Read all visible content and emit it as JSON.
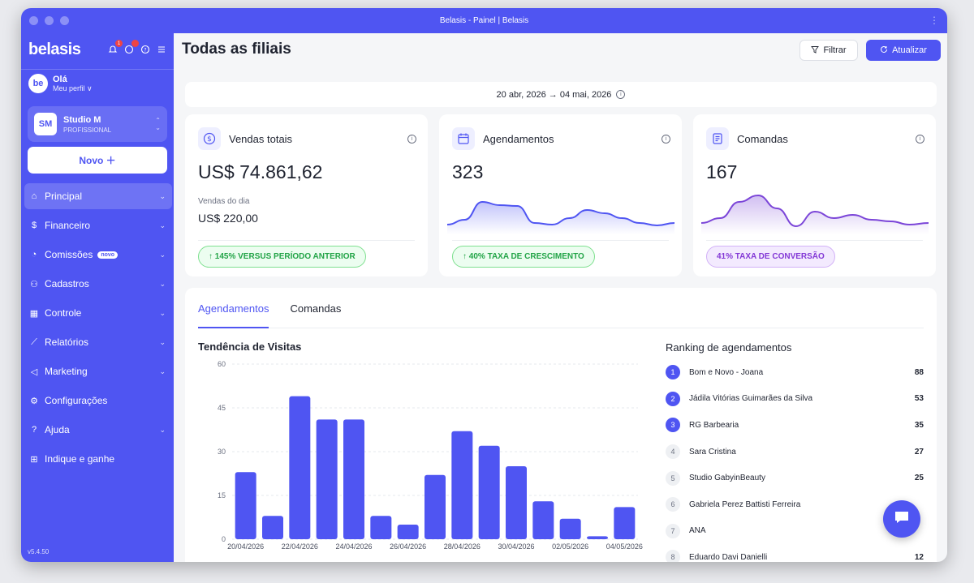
{
  "window": {
    "title": "Belasis - Painel | Belasis"
  },
  "sidebar": {
    "logo": "belasis",
    "notif_count": "1",
    "user": {
      "avatar": "be",
      "hello": "Olá",
      "profile": "Meu perfil ∨"
    },
    "studio": {
      "avatar": "SM",
      "name": "Studio M",
      "role": "PROFISSIONAL"
    },
    "new_button": "Novo ＋",
    "items": [
      {
        "label": "Principal",
        "icon": "home-icon",
        "glyph": "⌂",
        "chevron": true,
        "active": true
      },
      {
        "label": "Financeiro",
        "icon": "dollar-circle-icon",
        "glyph": "$",
        "chevron": true
      },
      {
        "label": "Comissões",
        "icon": "pie-icon",
        "glyph": "◔",
        "chevron": true,
        "badge": "novo"
      },
      {
        "label": "Cadastros",
        "icon": "users-icon",
        "glyph": "⚇",
        "chevron": true
      },
      {
        "label": "Controle",
        "icon": "grid-icon",
        "glyph": "▦",
        "chevron": true
      },
      {
        "label": "Relatórios",
        "icon": "chart-line-icon",
        "glyph": "⟋",
        "chevron": true
      },
      {
        "label": "Marketing",
        "icon": "megaphone-icon",
        "glyph": "◁",
        "chevron": true
      },
      {
        "label": "Configurações",
        "icon": "gear-icon",
        "glyph": "⚙",
        "chevron": false
      },
      {
        "label": "Ajuda",
        "icon": "help-icon",
        "glyph": "?",
        "chevron": true
      },
      {
        "label": "Indique e ganhe",
        "icon": "gift-icon",
        "glyph": "⊞",
        "chevron": false
      }
    ],
    "version": "v5.4.50"
  },
  "header": {
    "title": "Todas as filiais",
    "filter_label": "Filtrar",
    "update_label": "Atualizar"
  },
  "date_range": "20 abr, 2026 → 04 mai, 2026",
  "cards": {
    "sales": {
      "title": "Vendas totais",
      "value": "US$ 74.861,62",
      "sub_label": "Vendas do dia",
      "sub_value": "US$ 220,00",
      "pill": "↑ 145% VERSUS PERÍODO ANTERIOR"
    },
    "appointments": {
      "title": "Agendamentos",
      "value": "323",
      "pill": "↑ 40% TAXA DE CRESCIMENTO"
    },
    "orders": {
      "title": "Comandas",
      "value": "167",
      "pill": "41% TAXA DE CONVERSÃO"
    }
  },
  "colors": {
    "brand": "#4f55f2",
    "green": "#22a447",
    "purple": "#8338d6",
    "purple_line": "#7b45d8"
  },
  "tabs": [
    {
      "label": "Agendamentos",
      "active": true
    },
    {
      "label": "Comandas",
      "active": false
    }
  ],
  "chart_data": {
    "type": "bar",
    "title": "Tendência de Visitas",
    "x_tick_labels": [
      "20/04/2026",
      "22/04/2026",
      "24/04/2026",
      "26/04/2026",
      "28/04/2026",
      "30/04/2026",
      "02/05/2026",
      "04/05/2026"
    ],
    "categories": [
      "20/04/2026",
      "21/04/2026",
      "22/04/2026",
      "23/04/2026",
      "24/04/2026",
      "25/04/2026",
      "26/04/2026",
      "27/04/2026",
      "28/04/2026",
      "29/04/2026",
      "30/04/2026",
      "01/05/2026",
      "02/05/2026",
      "03/05/2026",
      "04/05/2026"
    ],
    "values": [
      23,
      8,
      49,
      41,
      41,
      8,
      5,
      22,
      37,
      32,
      25,
      13,
      7,
      1,
      11
    ],
    "ylim": [
      0,
      60
    ],
    "yticks": [
      0,
      15,
      30,
      45,
      60
    ],
    "grid": true
  },
  "sparklines": {
    "appointments": [
      12,
      18,
      40,
      36,
      35,
      14,
      12,
      20,
      30,
      26,
      20,
      14,
      11,
      14
    ],
    "orders": [
      14,
      20,
      40,
      48,
      32,
      10,
      28,
      20,
      24,
      18,
      16,
      12,
      14
    ]
  },
  "ranking": {
    "title": "Ranking de agendamentos",
    "items": [
      {
        "pos": "1",
        "name": "Bom e Novo - Joana",
        "count": "88"
      },
      {
        "pos": "2",
        "name": "Jádila Vitórias Guimarães da Silva",
        "count": "53"
      },
      {
        "pos": "3",
        "name": "RG Barbearia",
        "count": "35"
      },
      {
        "pos": "4",
        "name": "Sara Cristina",
        "count": "27"
      },
      {
        "pos": "5",
        "name": "Studio GabyinBeauty",
        "count": "25"
      },
      {
        "pos": "6",
        "name": "Gabriela Perez Battisti Ferreira",
        "count": ""
      },
      {
        "pos": "7",
        "name": "ANA",
        "count": ""
      },
      {
        "pos": "8",
        "name": "Eduardo Davi Danielli",
        "count": "12"
      }
    ]
  }
}
